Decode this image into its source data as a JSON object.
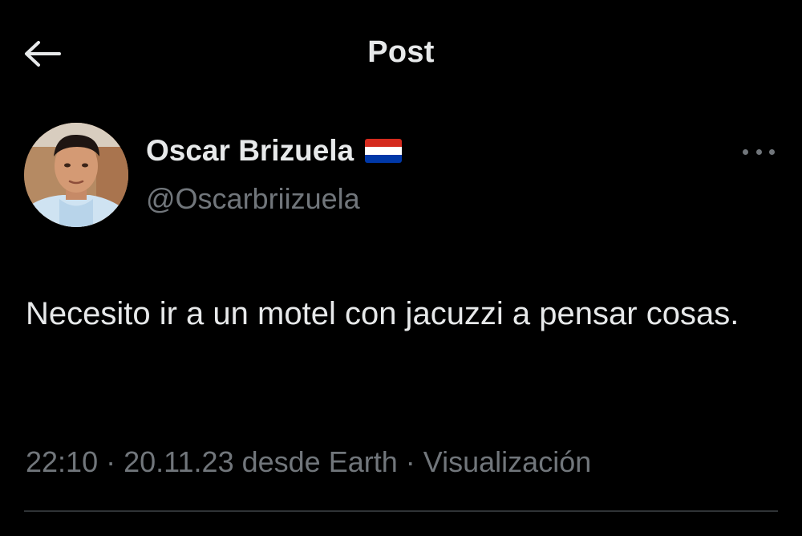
{
  "header": {
    "title": "Post",
    "back_icon": "arrow-left-icon"
  },
  "author": {
    "display_name": "Oscar Brizuela",
    "flag_icon": "paraguay-flag-icon",
    "handle": "@Oscarbriizuela",
    "more_icon": "more-horizontal-icon"
  },
  "post": {
    "text": "Necesito ir a un motel con jacuzzi a pensar cosas.",
    "time": "22:10",
    "date": "20.11.23",
    "source": "desde Earth",
    "views_label": "Visualización",
    "separator": "·"
  },
  "colors": {
    "background": "#000000",
    "text_primary": "#e7e9ea",
    "text_secondary": "#71767b",
    "divider": "#2f3336",
    "flag_red": "#d52b1e",
    "flag_white": "#ffffff",
    "flag_blue": "#0038a8"
  }
}
